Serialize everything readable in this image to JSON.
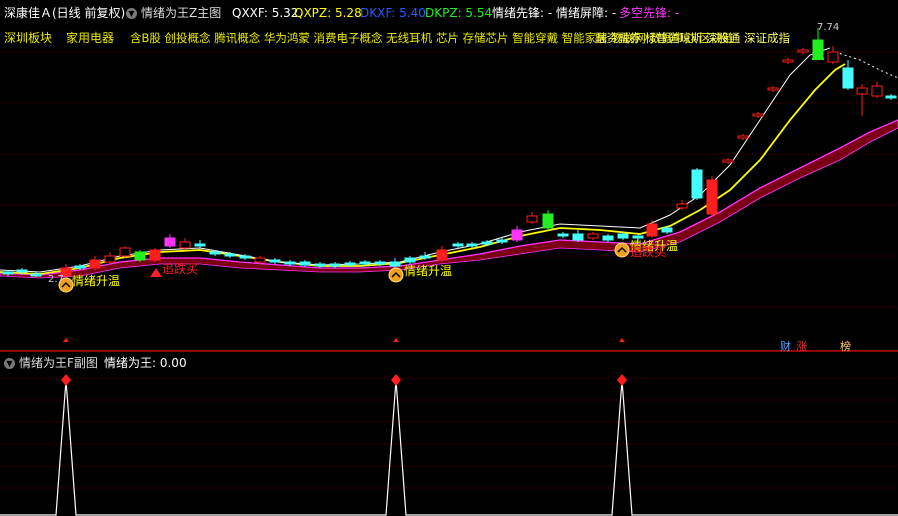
{
  "header": {
    "stock": "深康佳Ａ(日线 前复权)",
    "indicator": "情绪为王Z主图",
    "qxxf": "QXXF: 5.32",
    "qxpz": "QXPZ: 5.28",
    "dkxf": "DKXF: 5.40",
    "dkpz": "DKPZ: 5.54",
    "qxxx": "情绪先锋: -",
    "qxpz2": "情绪屏障: -",
    "dkxx": "多空先锋: -"
  },
  "blocks": {
    "region": "深圳板块",
    "industry": "家用电器",
    "concepts": "含B股 创投概念 腾讯概念 华为鸿蒙 消费电子概念 无线耳机 芯片 存储芯片 智能穿戴 智能家居 物联网 数据中心 区块链",
    "overlay": "融资融券 标普道琼斯 深股通 深证成指"
  },
  "annotations": {
    "warm": "情绪升温",
    "drop": "追跌买",
    "high": "7.74",
    "low": "2.7"
  },
  "markers": {
    "cai": "财",
    "zhang": "涨",
    "bang": "榜"
  },
  "sub": {
    "title": "情绪为王F副图",
    "value": "情绪为王: 0.00"
  },
  "colors": {
    "red": "#ff1e1e",
    "cyan": "#44ffff",
    "yellow": "#ffff00",
    "magenta": "#ff33ff",
    "green": "#22ee22",
    "band": "#7a0014"
  }
}
